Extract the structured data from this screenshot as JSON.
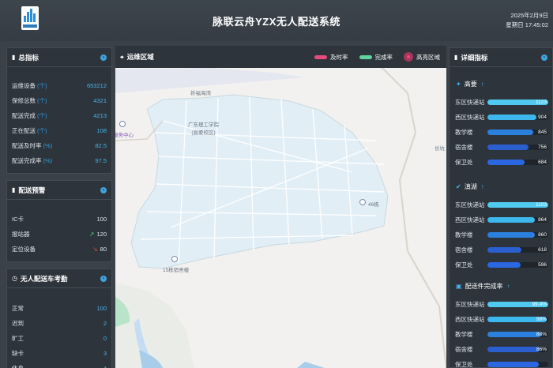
{
  "header": {
    "title": "脉联云舟YZX无人配送系统",
    "date": "2025年2月9日",
    "weekday_time": "星期日 17:45:02"
  },
  "summary": {
    "title": "总指标",
    "rows": [
      {
        "label": "运维设备",
        "unit": "(个)",
        "value": "653212"
      },
      {
        "label": "保修总数",
        "unit": "(个)",
        "value": "4321"
      },
      {
        "label": "配送完成",
        "unit": "(个)",
        "value": "4213"
      },
      {
        "label": "正在配送",
        "unit": "(个)",
        "value": "108"
      },
      {
        "label": "配送及时率",
        "unit": "(%)",
        "value": "82.5"
      },
      {
        "label": "配送完成率",
        "unit": "(%)",
        "value": "97.5"
      }
    ]
  },
  "warning": {
    "title": "配送预警",
    "rows": [
      {
        "label": "IC卡",
        "value": "100",
        "trend": "none"
      },
      {
        "label": "报站器",
        "value": "120",
        "trend": "up"
      },
      {
        "label": "定位设备",
        "value": "80",
        "trend": "down"
      }
    ]
  },
  "attendance": {
    "title": "无人配送车考勤",
    "rows": [
      {
        "label": "正常",
        "value": "100"
      },
      {
        "label": "迟到",
        "value": "2"
      },
      {
        "label": "旷工",
        "value": "0"
      },
      {
        "label": "缺卡",
        "value": "3"
      },
      {
        "label": "休息",
        "value": "4"
      }
    ]
  },
  "map": {
    "title": "运维区域",
    "legend": [
      {
        "label": "及时率",
        "color": "#e54b7c"
      },
      {
        "label": "完成率",
        "color": "#5fd39a"
      },
      {
        "label": "高亮区域",
        "color": "#a8365a"
      }
    ],
    "labels": {
      "poi1": "祈福海湾",
      "campus": "广东理工学院\n(高要校区)",
      "center": "服务中心",
      "dorm46": "46栋",
      "dorm15": "15栋宿舍楼",
      "edge": "长坑"
    }
  },
  "detail": {
    "title": "详细指标",
    "groups": [
      {
        "name": "高要",
        "arrow": "↑",
        "items": [
          {
            "label": "东区快递站",
            "value": "1123",
            "fill": 1.0,
            "color": "#4fc9ef"
          },
          {
            "label": "西区快递站",
            "value": "904",
            "fill": 0.8,
            "color": "#3cb8ec"
          },
          {
            "label": "教学楼",
            "value": "845",
            "fill": 0.75,
            "color": "#2b80dd"
          },
          {
            "label": "宿舍楼",
            "value": "756",
            "fill": 0.67,
            "color": "#2b5fcf"
          },
          {
            "label": "保卫处",
            "value": "684",
            "fill": 0.61,
            "color": "#2a67e0"
          }
        ]
      },
      {
        "name": "滇湖",
        "arrow": "↑",
        "items": [
          {
            "label": "东区快递站",
            "value": "1103",
            "fill": 1.0,
            "color": "#4fc9ef"
          },
          {
            "label": "西区快递站",
            "value": "864",
            "fill": 0.78,
            "color": "#3cb8ec"
          },
          {
            "label": "教学楼",
            "value": "860",
            "fill": 0.78,
            "color": "#2b80dd"
          },
          {
            "label": "宿舍楼",
            "value": "618",
            "fill": 0.56,
            "color": "#2b5fcf"
          },
          {
            "label": "保卫处",
            "value": "596",
            "fill": 0.54,
            "color": "#2a67e0"
          }
        ]
      },
      {
        "name": "配送件完成率",
        "arrow": "↑",
        "items": [
          {
            "label": "东区快递站",
            "value": "99.4%",
            "fill": 0.994,
            "color": "#4fc9ef"
          },
          {
            "label": "西区快递站",
            "value": "98%",
            "fill": 0.98,
            "color": "#3cb8ec"
          },
          {
            "label": "教学楼",
            "value": "88%",
            "fill": 0.88,
            "color": "#2b80dd"
          },
          {
            "label": "宿舍楼",
            "value": "86%",
            "fill": 0.86,
            "color": "#2b5fcf"
          },
          {
            "label": "保卫处",
            "value": "",
            "fill": 0.84,
            "color": "#2a67e0"
          }
        ]
      }
    ]
  }
}
